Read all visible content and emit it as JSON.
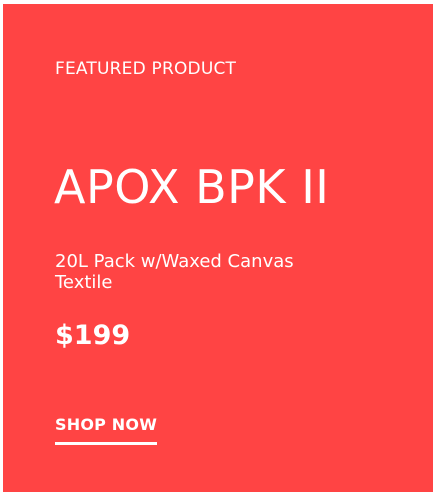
{
  "card": {
    "background_color": "#ff4444",
    "text_color": "#ffffff",
    "eyebrow": "FEATURED PRODUCT",
    "title": "APOX BPK II",
    "subtitle": "20L Pack w/Waxed Canvas Textile",
    "price": "$199",
    "cta_label": "SHOP NOW"
  }
}
